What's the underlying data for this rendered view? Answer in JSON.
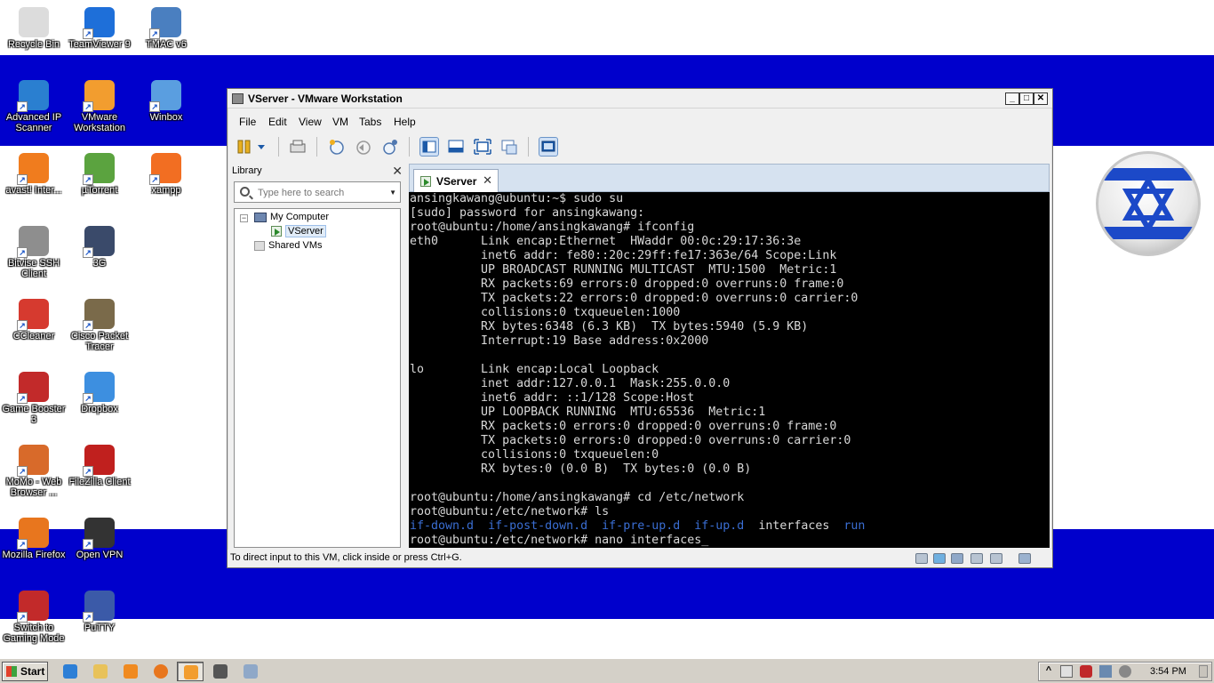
{
  "desktop": {
    "icons": [
      {
        "label": "Recycle Bin",
        "icon": "recycle-bin-icon",
        "color": "#dcdcdc"
      },
      {
        "label": "TeamViewer 9",
        "icon": "teamviewer-icon",
        "color": "#1e6fd9"
      },
      {
        "label": "TMAC v6",
        "icon": "tmac-icon",
        "color": "#4a7fc0"
      },
      {
        "label": "Advanced IP Scanner",
        "icon": "ip-scanner-icon",
        "color": "#2a7fd0"
      },
      {
        "label": "VMware Workstation",
        "icon": "vmware-icon",
        "color": "#f29d2f"
      },
      {
        "label": "Winbox",
        "icon": "winbox-icon",
        "color": "#5a9ee0"
      },
      {
        "label": "avast! Inter...",
        "icon": "avast-icon",
        "color": "#f07c1e"
      },
      {
        "label": "µTorrent",
        "icon": "utorrent-icon",
        "color": "#5ba33f"
      },
      {
        "label": "xampp",
        "icon": "xampp-icon",
        "color": "#f26e22"
      },
      {
        "label": "Bitvise SSH Client",
        "icon": "bitvise-icon",
        "color": "#8e8e8e"
      },
      {
        "label": "3G",
        "icon": "modem-icon",
        "color": "#3a4a6a"
      },
      {
        "label": "CCleaner",
        "icon": "ccleaner-icon",
        "color": "#d63a2f"
      },
      {
        "label": "Cisco Packet Tracer",
        "icon": "packet-tracer-icon",
        "color": "#7a6a4a"
      },
      {
        "label": "Game Booster 3",
        "icon": "game-booster-icon",
        "color": "#c22a2a"
      },
      {
        "label": "Dropbox",
        "icon": "dropbox-icon",
        "color": "#3d8fe0"
      },
      {
        "label": "MoMo - Web Browser ...",
        "icon": "momo-icon",
        "color": "#d86a2a"
      },
      {
        "label": "FileZilla Client",
        "icon": "filezilla-icon",
        "color": "#c0201e"
      },
      {
        "label": "Mozilla Firefox",
        "icon": "firefox-icon",
        "color": "#e8761e"
      },
      {
        "label": "Open VPN",
        "icon": "openvpn-icon",
        "color": "#333333"
      },
      {
        "label": "Switch to Gaming Mode",
        "icon": "gaming-mode-icon",
        "color": "#c22a2a"
      },
      {
        "label": "PuTTY",
        "icon": "putty-icon",
        "color": "#3b5aa8"
      }
    ]
  },
  "window": {
    "title": "VServer - VMware Workstation",
    "menu": [
      "File",
      "Edit",
      "View",
      "VM",
      "Tabs",
      "Help"
    ],
    "library": {
      "title": "Library",
      "search_placeholder": "Type here to search",
      "tree": {
        "root": "My Computer",
        "vm": "VServer",
        "shared": "Shared VMs"
      }
    },
    "tab": {
      "label": "VServer"
    },
    "status_text": "To direct input to this VM, click inside or press Ctrl+G."
  },
  "terminal": {
    "lines": [
      "ansingkawang@ubuntu:~$ sudo su",
      "[sudo] password for ansingkawang:",
      "root@ubuntu:/home/ansingkawang# ifconfig",
      "eth0      Link encap:Ethernet  HWaddr 00:0c:29:17:36:3e",
      "          inet6 addr: fe80::20c:29ff:fe17:363e/64 Scope:Link",
      "          UP BROADCAST RUNNING MULTICAST  MTU:1500  Metric:1",
      "          RX packets:69 errors:0 dropped:0 overruns:0 frame:0",
      "          TX packets:22 errors:0 dropped:0 overruns:0 carrier:0",
      "          collisions:0 txqueuelen:1000",
      "          RX bytes:6348 (6.3 KB)  TX bytes:5940 (5.9 KB)",
      "          Interrupt:19 Base address:0x2000",
      "",
      "lo        Link encap:Local Loopback",
      "          inet addr:127.0.0.1  Mask:255.0.0.0",
      "          inet6 addr: ::1/128 Scope:Host",
      "          UP LOOPBACK RUNNING  MTU:65536  Metric:1",
      "          RX packets:0 errors:0 dropped:0 overruns:0 frame:0",
      "          TX packets:0 errors:0 dropped:0 overruns:0 carrier:0",
      "          collisions:0 txqueuelen:0",
      "          RX bytes:0 (0.0 B)  TX bytes:0 (0.0 B)",
      "",
      "root@ubuntu:/home/ansingkawang# cd /etc/network",
      "root@ubuntu:/etc/network# ls"
    ],
    "ls_output": {
      "dirs": [
        "if-down.d",
        "if-post-down.d",
        "if-pre-up.d",
        "if-up.d"
      ],
      "file": "interfaces",
      "last_dir": "run"
    },
    "last_line": "root@ubuntu:/etc/network# nano interfaces",
    "cursor": "_",
    "dir_color": "#3a6ed3",
    "text_color": "#d8d8d8"
  },
  "taskbar": {
    "start_label": "Start",
    "clock": "3:54 PM"
  }
}
